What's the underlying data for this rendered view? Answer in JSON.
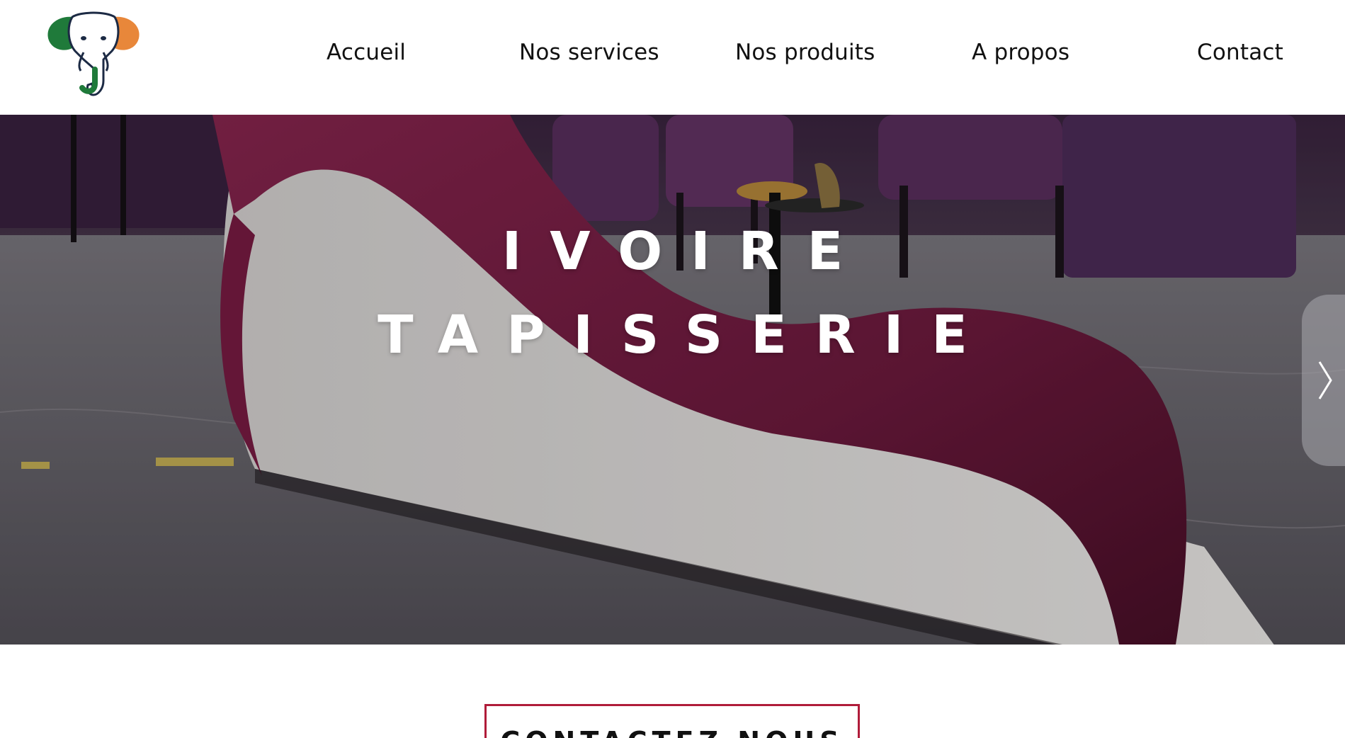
{
  "brand": {
    "logo_icon": "elephant-logo-icon",
    "colors": {
      "green": "#1f7a3a",
      "orange": "#e8873a",
      "navy": "#1c2a44"
    }
  },
  "nav": {
    "items": [
      {
        "label": "Accueil"
      },
      {
        "label": "Nos services"
      },
      {
        "label": "Nos produits"
      },
      {
        "label": "A propos"
      },
      {
        "label": "Contact"
      }
    ]
  },
  "hero": {
    "title_line1": "IVOIRE",
    "title_line2": "TAPISSERIE",
    "next_icon": "chevron-right-icon",
    "colors": {
      "sofa": "#7a1f45",
      "sofa_base": "#e9e6e4",
      "floor": "#6b6870"
    }
  },
  "cta": {
    "label": "CONTACTEZ NOUS",
    "border_color": "#b01c3a"
  }
}
